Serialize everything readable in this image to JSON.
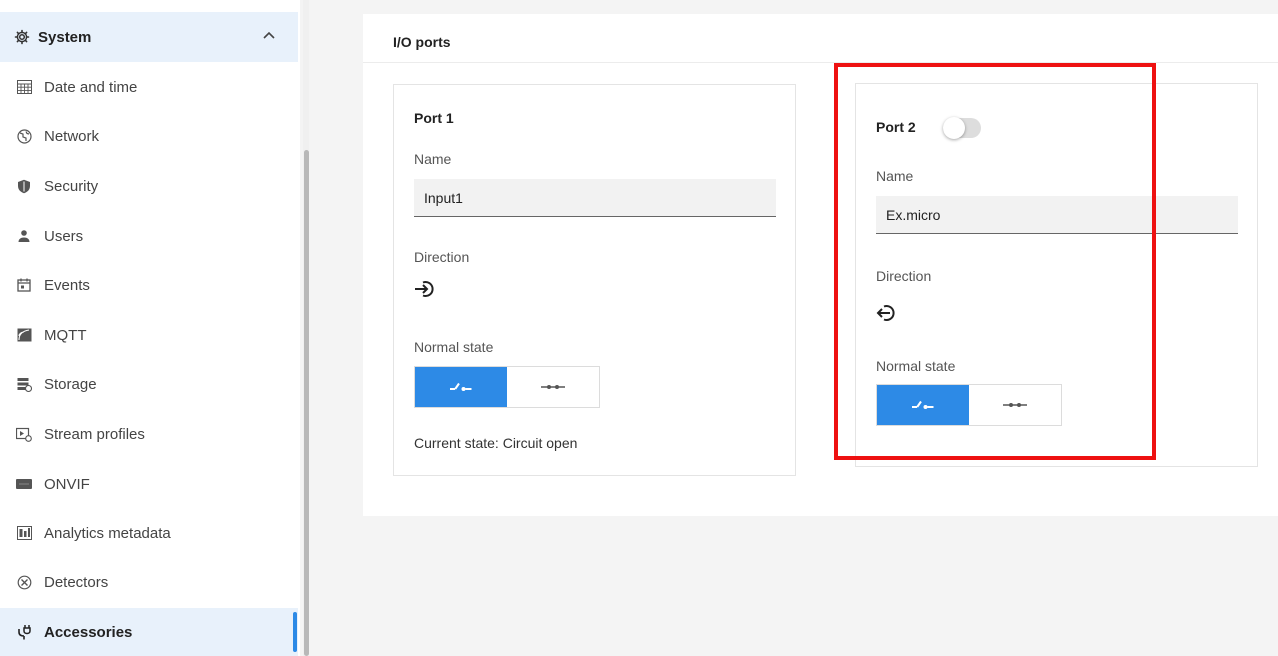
{
  "sidebar": {
    "section": {
      "label": "System",
      "icon": "gear-icon",
      "expanded": true
    },
    "items": [
      {
        "label": "Date and time",
        "icon": "calendar-grid-icon"
      },
      {
        "label": "Network",
        "icon": "globe-icon"
      },
      {
        "label": "Security",
        "icon": "shield-icon"
      },
      {
        "label": "Users",
        "icon": "user-icon"
      },
      {
        "label": "Events",
        "icon": "calendar-icon"
      },
      {
        "label": "MQTT",
        "icon": "mqtt-icon"
      },
      {
        "label": "Storage",
        "icon": "storage-icon"
      },
      {
        "label": "Stream profiles",
        "icon": "stream-profile-icon"
      },
      {
        "label": "ONVIF",
        "icon": "onvif-icon"
      },
      {
        "label": "Analytics metadata",
        "icon": "analytics-icon"
      },
      {
        "label": "Detectors",
        "icon": "detector-icon"
      },
      {
        "label": "Accessories",
        "icon": "plug-icon",
        "active": true
      }
    ]
  },
  "main": {
    "title": "I/O ports",
    "ports": [
      {
        "title": "Port 1",
        "name_label": "Name",
        "name_value": "Input1",
        "direction_label": "Direction",
        "direction": "input",
        "direction_icon": "input-arrow-icon",
        "normal_state_label": "Normal state",
        "normal_state_selected": "open",
        "current_state": "Current state: Circuit open"
      },
      {
        "title": "Port 2",
        "toggle_on": false,
        "name_label": "Name",
        "name_value": "Ex.micro",
        "direction_label": "Direction",
        "direction": "output",
        "direction_icon": "output-arrow-icon",
        "normal_state_label": "Normal state",
        "normal_state_selected": "open"
      }
    ]
  },
  "colors": {
    "accent": "#2d8ae6",
    "highlight": "#ee1111",
    "sidebar_active_bg": "#e8f1fb"
  }
}
